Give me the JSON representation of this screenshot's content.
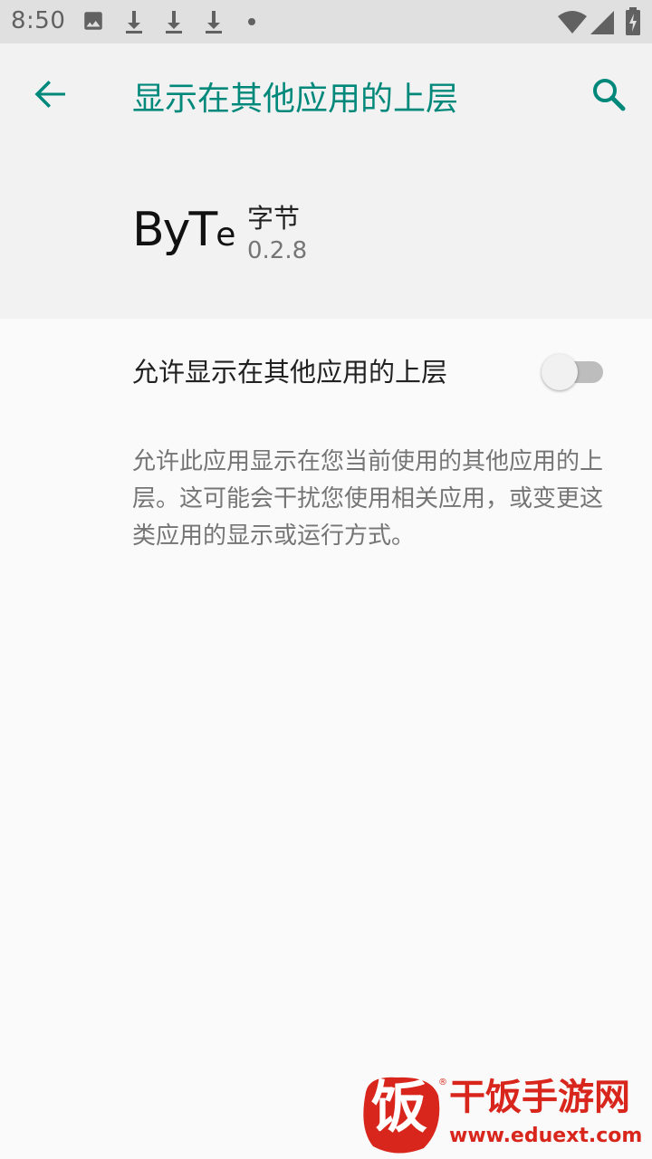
{
  "status_bar": {
    "time": "8:50",
    "icons": [
      "image-icon",
      "download-icon",
      "download-icon",
      "download-icon",
      "dot-icon",
      "wifi-icon",
      "signal-icon",
      "battery-icon"
    ]
  },
  "app_bar": {
    "title": "显示在其他应用的上层",
    "back_icon": "arrow-back-icon",
    "search_icon": "search-icon"
  },
  "app_info": {
    "logo_text": "ByT",
    "logo_text_small": "e",
    "name": "字节",
    "version": "0.2.8"
  },
  "permission": {
    "label": "允许显示在其他应用的上层",
    "enabled": false
  },
  "description": "允许此应用显示在您当前使用的其他应用的上层。这可能会干扰您使用相关应用，或变更这类应用的显示或运行方式。",
  "watermark": {
    "seal_char": "饭",
    "name": "干饭手游网",
    "url": "www.eduext.com",
    "reg": "®"
  },
  "colors": {
    "accent": "#00897b",
    "watermark_red": "#d9261c"
  }
}
